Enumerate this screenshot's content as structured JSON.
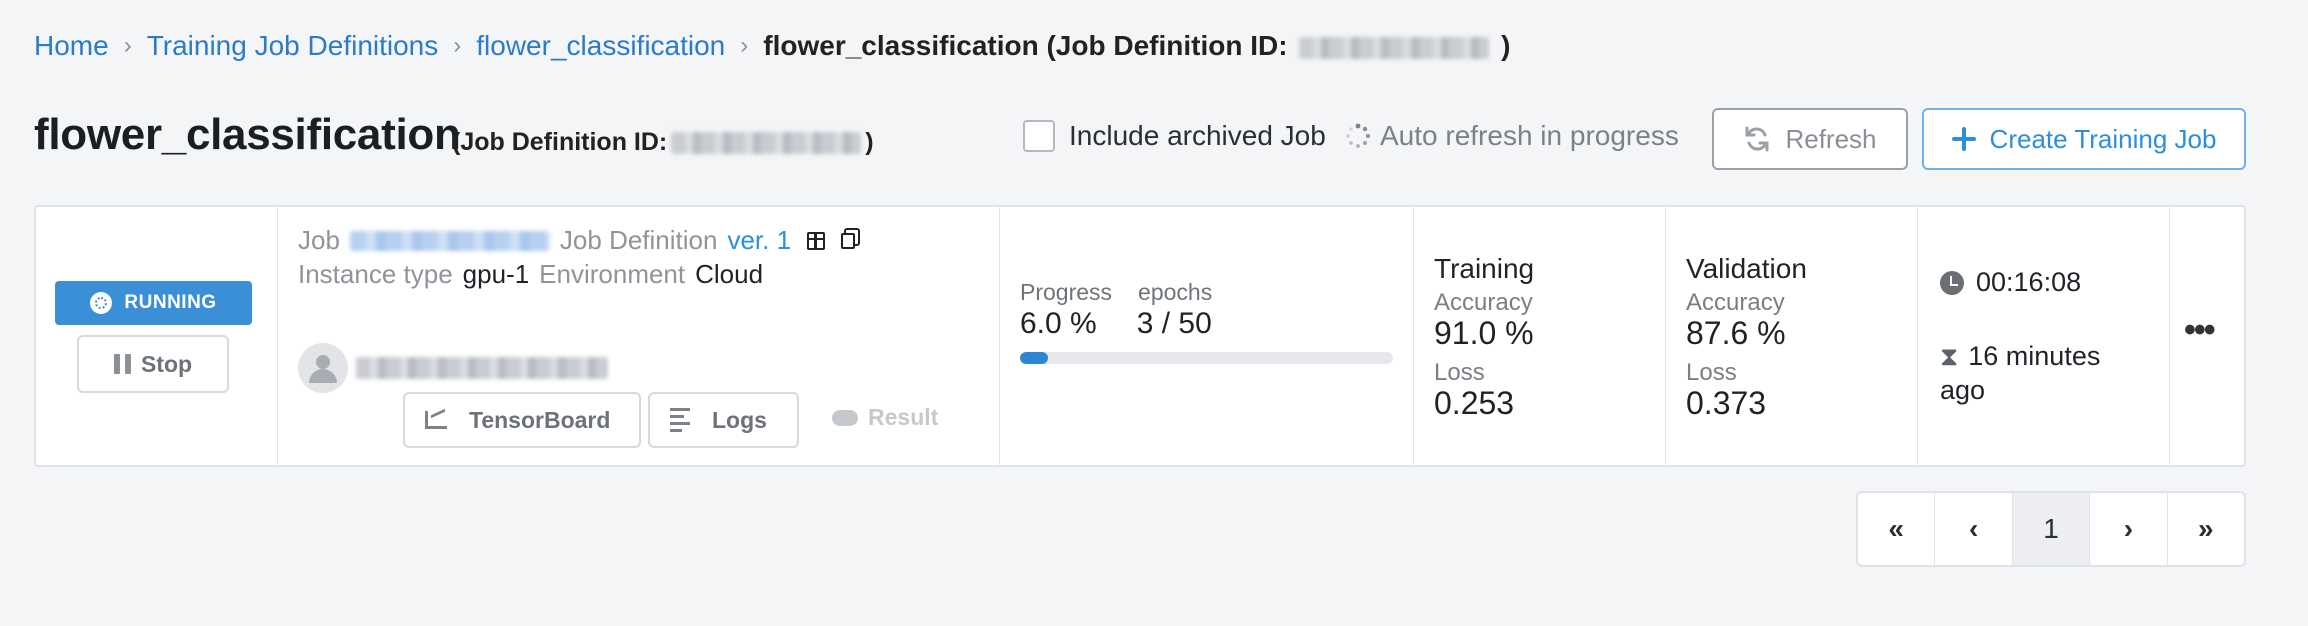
{
  "breadcrumb": {
    "home": "Home",
    "definitions": "Training Job Definitions",
    "definition": "flower_classification",
    "current_prefix": "flower_classification (Job Definition ID:",
    "current_suffix": ")"
  },
  "header": {
    "title": "flower_classification",
    "id_prefix": "(Job Definition ID:",
    "id_suffix": ")",
    "include_archived_label": "Include archived Job",
    "include_archived_checked": false,
    "auto_refresh_label": "Auto refresh in progress",
    "refresh_label": "Refresh",
    "create_label": "Create Training Job"
  },
  "job": {
    "status": "RUNNING",
    "status_color": "#3a8fd6",
    "stop_label": "Stop",
    "job_label": "Job",
    "definition_label": "Job Definition",
    "version": "ver. 1",
    "instance_label": "Instance type",
    "instance_value": "gpu-1",
    "environment_label": "Environment",
    "environment_value": "Cloud",
    "tensorboard_label": "TensorBoard",
    "logs_label": "Logs",
    "result_label": "Result",
    "progress_label": "Progress",
    "progress_value": "6.0 %",
    "progress_fraction": 0.06,
    "epochs_label": "epochs",
    "epochs_value": "3 / 50",
    "training": {
      "title": "Training",
      "accuracy_label": "Accuracy",
      "accuracy_value": "91.0 %",
      "loss_label": "Loss",
      "loss_value": "0.253"
    },
    "validation": {
      "title": "Validation",
      "accuracy_label": "Accuracy",
      "accuracy_value": "87.6 %",
      "loss_label": "Loss",
      "loss_value": "0.373"
    },
    "elapsed": "00:16:08",
    "started_ago": "16 minutes ago",
    "more_label": "•••"
  },
  "pagination": {
    "first": "«",
    "prev": "‹",
    "current": "1",
    "next": "›",
    "last": "»"
  },
  "icons": {
    "refresh": "refresh-icon",
    "plus": "plus-icon",
    "clock": "clock-icon",
    "hourglass": "hourglass-icon",
    "accent": "#2b8fde"
  }
}
